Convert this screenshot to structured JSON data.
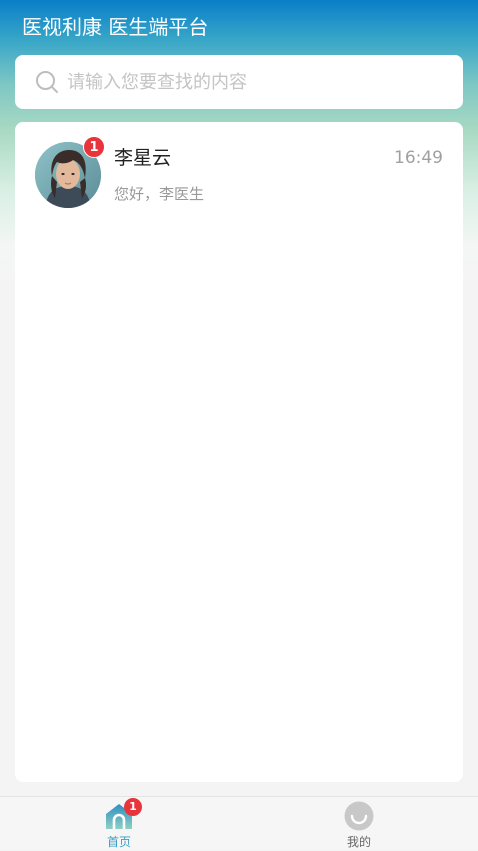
{
  "header": {
    "title": "医视利康 医生端平台"
  },
  "search": {
    "placeholder": "请输入您要查找的内容",
    "value": "",
    "icon": "search-icon"
  },
  "conversations": [
    {
      "name": "李星云",
      "time": "16:49",
      "preview": "您好，李医生",
      "unread": "1",
      "avatar_icon": "avatar"
    }
  ],
  "tabbar": {
    "tabs": [
      {
        "label": "首页",
        "icon": "home-icon",
        "badge": "1",
        "active": true
      },
      {
        "label": "我的",
        "icon": "profile-icon",
        "badge": "",
        "active": false
      }
    ]
  },
  "colors": {
    "header_top": "#0a7ec8",
    "accent": "#3a9fc4",
    "badge": "#e8353b"
  }
}
